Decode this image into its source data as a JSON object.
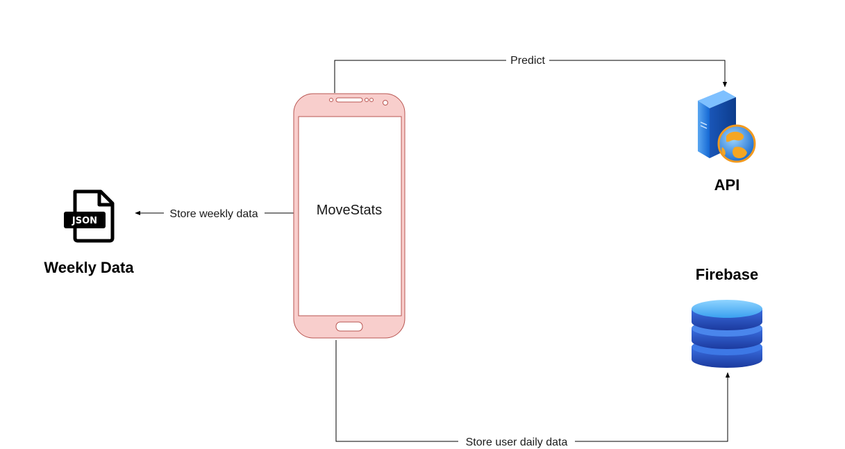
{
  "phone": {
    "label": "MoveStats",
    "color": "#f8cecc",
    "border_color": "#b85450"
  },
  "nodes": {
    "api": {
      "label": "API",
      "icon": "web-server-icon"
    },
    "firebase": {
      "label": "Firebase",
      "icon": "database-icon"
    },
    "weekly": {
      "label": "Weekly Data",
      "icon": "json-file-icon",
      "icon_text": "JSON"
    }
  },
  "edges": {
    "predict": "Predict",
    "store_weekly": "Store weekly data",
    "store_daily": "Store user daily data"
  },
  "colors": {
    "line": "#000000",
    "server_blue": "#1e73d8",
    "globe_orange": "#f29a1f",
    "db_blue": "#2d55c8"
  }
}
